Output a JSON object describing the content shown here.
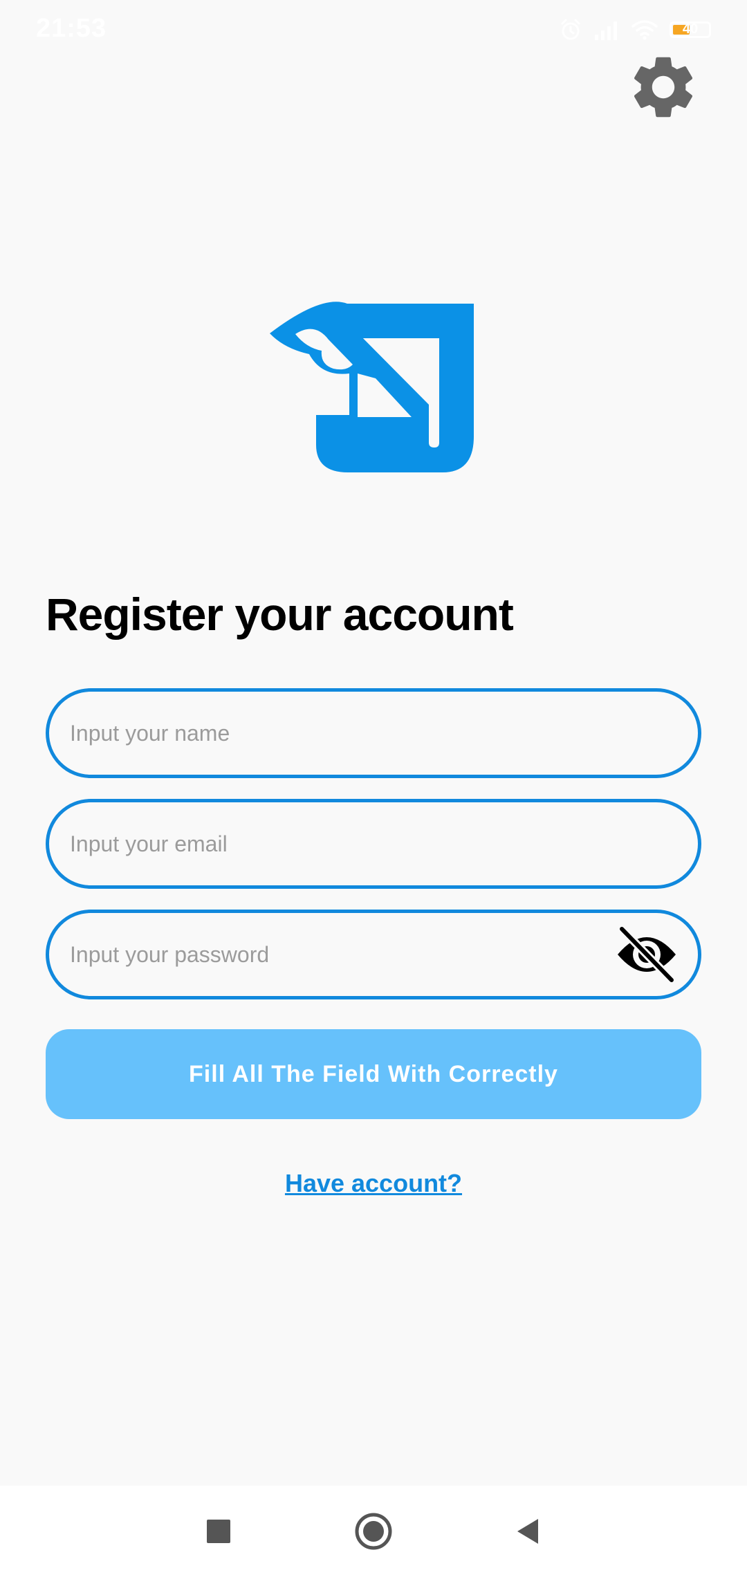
{
  "status_bar": {
    "time": "21:53",
    "battery_level": "40",
    "icons": [
      "alarm-icon",
      "signal-icon",
      "wifi-icon",
      "battery-icon"
    ]
  },
  "header": {
    "settings_icon": "gear-icon"
  },
  "logo": {
    "icon": "app-logo",
    "color": "#0b91e6"
  },
  "page": {
    "title": "Register your account"
  },
  "form": {
    "name_placeholder": "Input your name",
    "name_value": "",
    "email_placeholder": "Input your email",
    "email_value": "",
    "password_placeholder": "Input your password",
    "password_value": "",
    "password_toggle_icon": "eye-off-icon",
    "submit_label": "Fill All The Field With Correctly",
    "have_account_link": "Have account?"
  },
  "colors": {
    "accent": "#1189dd",
    "button_disabled": "#66c1fb",
    "background": "#f9f9f9",
    "settings_icon": "#666666"
  },
  "navigation_bar": {
    "buttons": [
      "recents-button",
      "home-button",
      "back-button"
    ]
  }
}
